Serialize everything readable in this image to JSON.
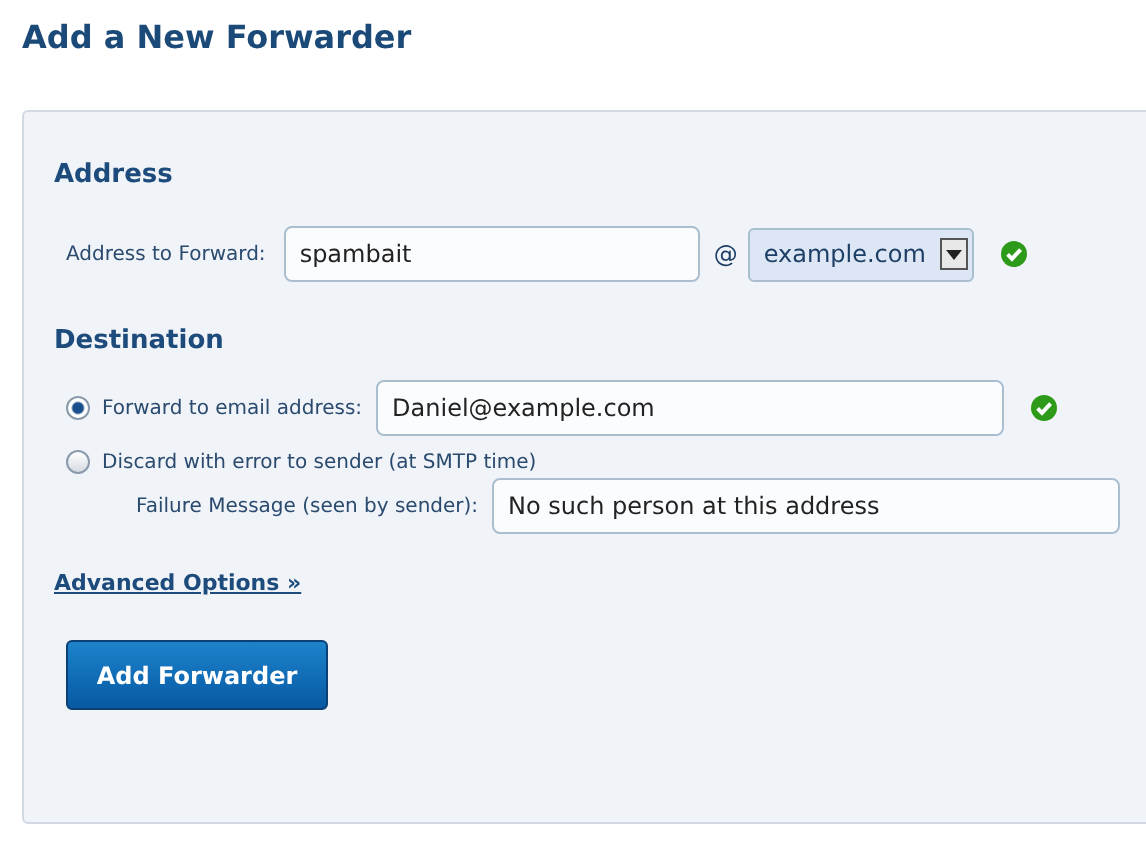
{
  "page_title": "Add a New Forwarder",
  "address": {
    "heading": "Address",
    "label": "Address to Forward:",
    "value": "spambait",
    "at": "@",
    "domain": "example.com",
    "valid": true
  },
  "destination": {
    "heading": "Destination",
    "options": [
      {
        "label": "Forward to email address:",
        "selected": true,
        "value": "Daniel@example.com",
        "valid": true
      },
      {
        "label": "Discard with error to sender (at SMTP time)",
        "selected": false
      }
    ],
    "failure": {
      "label": "Failure Message (seen by sender):",
      "value": "No such person at this address"
    }
  },
  "advanced_link": "Advanced Options »",
  "submit_button": "Add Forwarder"
}
